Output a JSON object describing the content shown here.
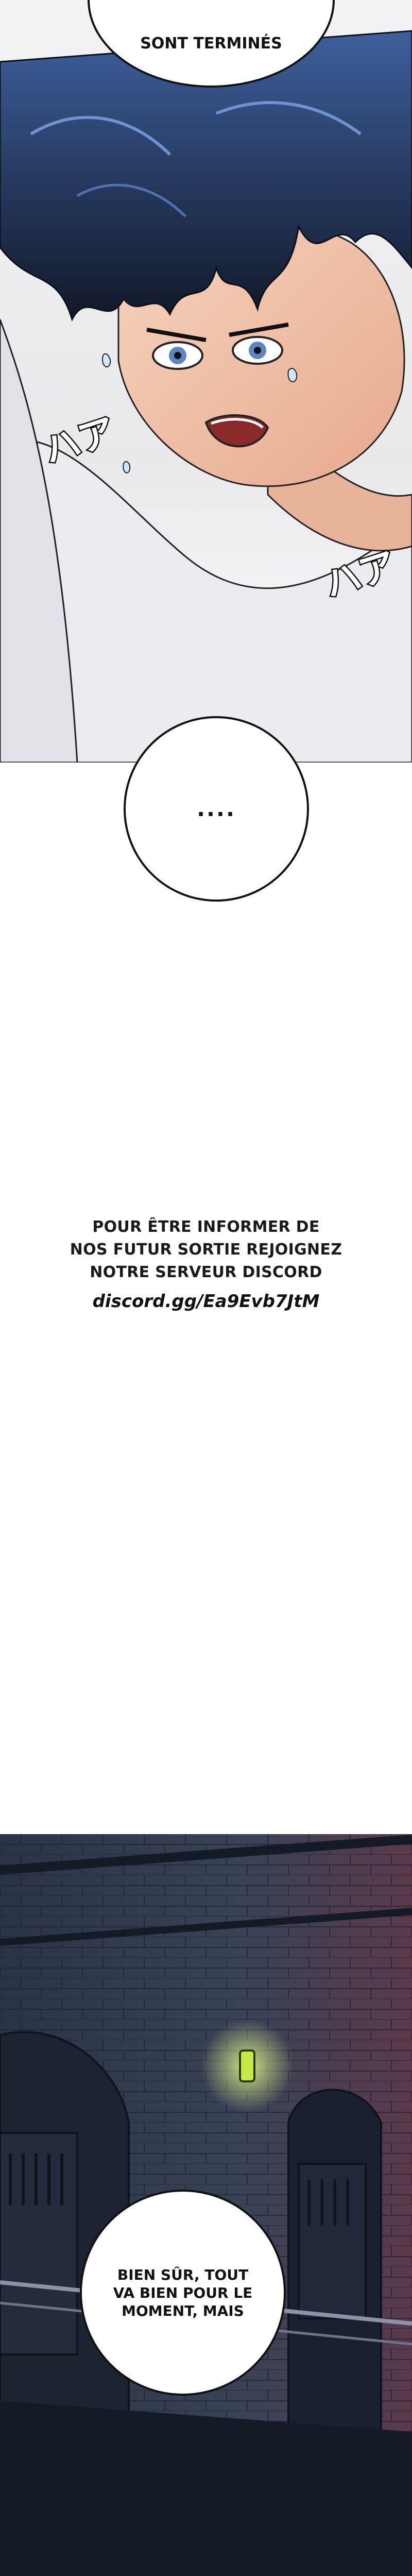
{
  "bubbles": {
    "top_text": "SONT TERMINÉS",
    "dots_text": "....",
    "bottom_lines": [
      "BIEN SÛR, TOUT",
      "VA BIEN POUR LE",
      "MOMENT, MAIS"
    ]
  },
  "sfx": {
    "left": "ハア",
    "right": "ハア"
  },
  "promo": {
    "lines": [
      "POUR ÊTRE INFORMER DE",
      "NOS FUTUR SORTIE REJOIGNEZ",
      "NOTRE SERVEUR DISCORD"
    ],
    "link": "discord.gg/Ea9Evb7JtM"
  },
  "colors": {
    "hair": "#1a2438",
    "hair_highlight": "#3d5f9c",
    "skin": "#f2c7ad",
    "shirt": "#ececf0",
    "wall": "#2a3344",
    "lamp": "#c8e84a"
  }
}
